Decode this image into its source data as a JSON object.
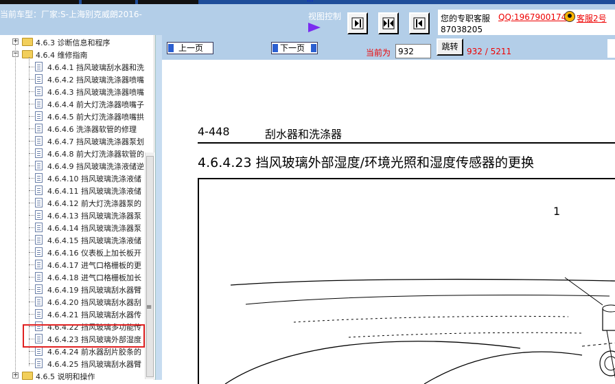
{
  "top_strip": {
    "link_text": "..."
  },
  "header": {
    "vehicle_info": "当前车型：厂家:S-上海别克威朗2016-",
    "view_control_label": "视图控制",
    "customer_service": {
      "label": "您的专职客服",
      "qq": "QQ:1967900174",
      "service2": "客服2号",
      "phone": "87038205"
    }
  },
  "tree": {
    "items": [
      {
        "label": "4.6.3 诊断信息和程序",
        "type": "folder",
        "expander": "+"
      },
      {
        "label": "4.6.4 维修指南",
        "type": "folder",
        "expander": "−"
      },
      {
        "label": "4.6.4.1 挡风玻璃刮水器和洗",
        "type": "doc"
      },
      {
        "label": "4.6.4.2 挡风玻璃洗涤器喷嘴",
        "type": "doc"
      },
      {
        "label": "4.6.4.3 挡风玻璃洗涤器喷嘴",
        "type": "doc"
      },
      {
        "label": "4.6.4.4 前大灯洗涤器喷嘴子",
        "type": "doc"
      },
      {
        "label": "4.6.4.5 前大灯洗涤器喷嘴拱",
        "type": "doc"
      },
      {
        "label": "4.6.4.6 洗涤器软管的修理",
        "type": "doc"
      },
      {
        "label": "4.6.4.7 挡风玻璃洗涤器泵划",
        "type": "doc"
      },
      {
        "label": "4.6.4.8 前大灯洗涤器软管的",
        "type": "doc"
      },
      {
        "label": "4.6.4.9 挡风玻璃洗涤液储逆",
        "type": "doc"
      },
      {
        "label": "4.6.4.10 挡风玻璃洗涤液储",
        "type": "doc"
      },
      {
        "label": "4.6.4.11 挡风玻璃洗涤液储",
        "type": "doc"
      },
      {
        "label": "4.6.4.12 前大灯洗涤器泵的",
        "type": "doc"
      },
      {
        "label": "4.6.4.13 挡风玻璃洗涤器泵",
        "type": "doc"
      },
      {
        "label": "4.6.4.14 挡风玻璃洗涤器泵",
        "type": "doc"
      },
      {
        "label": "4.6.4.15 挡风玻璃洗涤液储",
        "type": "doc"
      },
      {
        "label": "4.6.4.16 仪表板上加长板开",
        "type": "doc"
      },
      {
        "label": "4.6.4.17 进气口格栅板的更",
        "type": "doc"
      },
      {
        "label": "4.6.4.18 进气口格栅板加长",
        "type": "doc"
      },
      {
        "label": "4.6.4.19 挡风玻璃刮水器臂",
        "type": "doc"
      },
      {
        "label": "4.6.4.20 挡风玻璃刮水器刮",
        "type": "doc"
      },
      {
        "label": "4.6.4.21 挡风玻璃刮水器传",
        "type": "doc"
      },
      {
        "label": "4.6.4.22 挡风玻璃多功能传",
        "type": "doc"
      },
      {
        "label": "4.6.4.23 挡风玻璃外部湿度",
        "type": "doc"
      },
      {
        "label": "4.6.4.24 前水器刮片胶条的",
        "type": "doc"
      },
      {
        "label": "4.6.4.25 挡风玻璃刮水器臂",
        "type": "doc"
      },
      {
        "label": "4.6.5 说明和操作",
        "type": "folder",
        "expander": "+"
      }
    ],
    "scroll_grip": "≡"
  },
  "nav": {
    "prev_label": "上一页",
    "next_label": "下一页",
    "current_label": "当前为",
    "page_value": "932",
    "jump_label": "跳转",
    "page_count": "932 / 5211"
  },
  "document": {
    "page_number": "4-448",
    "section": "刮水器和洗涤器",
    "title": "4.6.4.23 挡风玻璃外部湿度/环境光照和湿度传感器的更换",
    "callout": "1"
  },
  "colors": {
    "header_bg": "#b3cee8",
    "highlight": "#e02020",
    "alert_text": "#e00000",
    "arrow": "#7a2cf0"
  }
}
